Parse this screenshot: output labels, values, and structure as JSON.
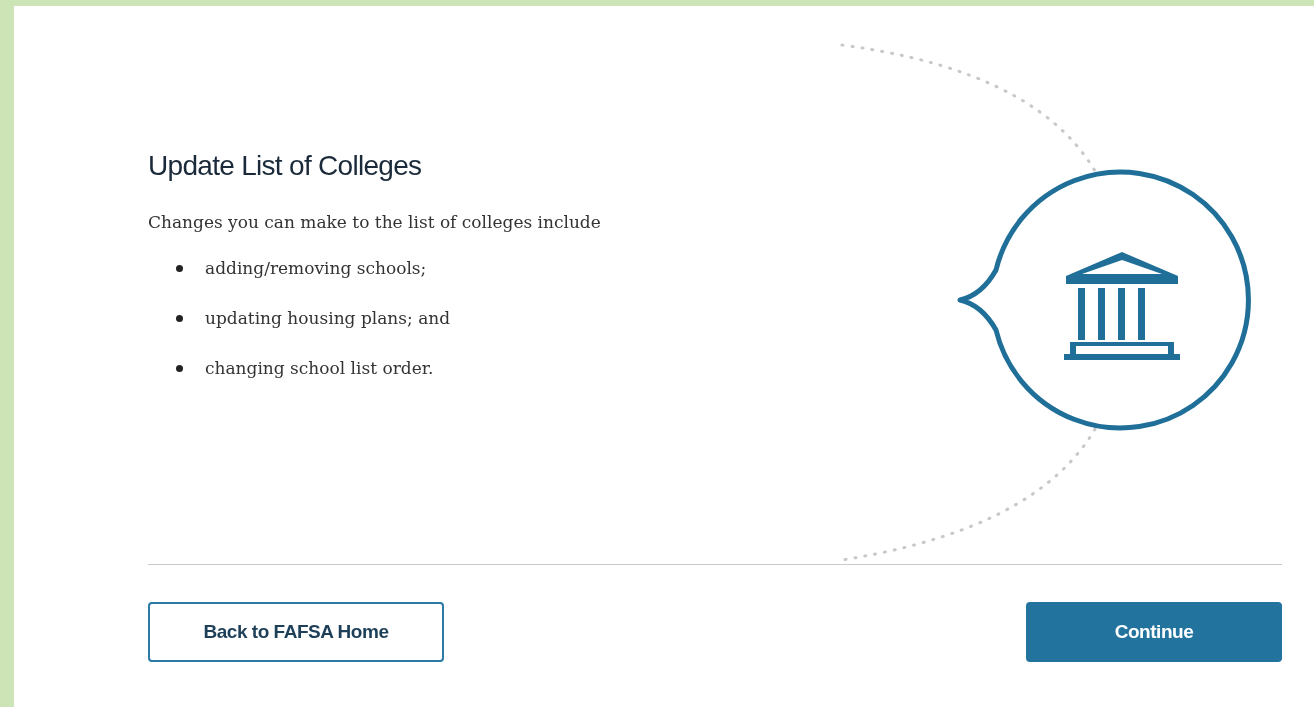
{
  "heading": "Update List of Colleges",
  "intro": "Changes you can make to the list of colleges include",
  "bullets": [
    "adding/removing schools;",
    "updating housing plans; and",
    "changing school list order."
  ],
  "buttons": [
    {
      "label": "Back to FAFSA Home",
      "kind": "outline"
    },
    {
      "label": "Continue",
      "kind": "primary"
    }
  ]
}
